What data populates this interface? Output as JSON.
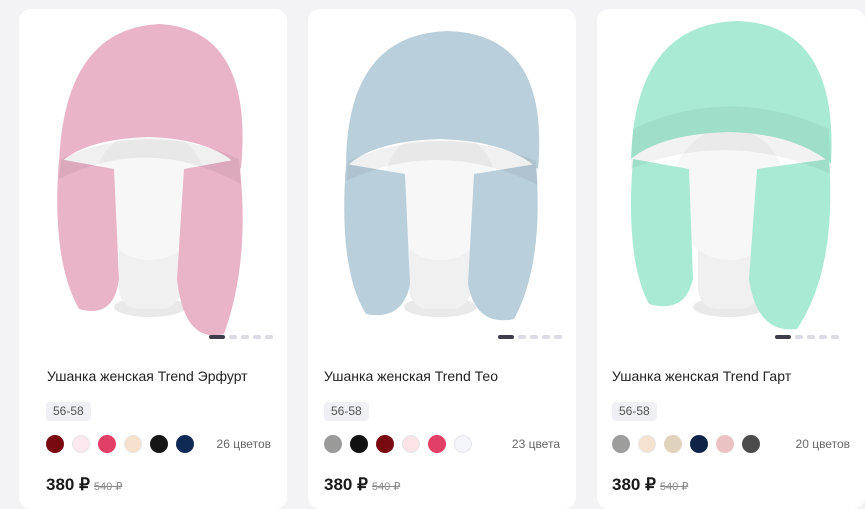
{
  "products": [
    {
      "title": "Ушанка женская Trend Эрфурт",
      "size": "56-58",
      "colors_count": "26 цветов",
      "price": "380 ₽",
      "old_price": "540 ₽",
      "hat_color": "#e9b3c8",
      "swatches": [
        "#7a0a12",
        "#fce8ee",
        "#e23f66",
        "#f5e1cc",
        "#161616",
        "#0f2a55"
      ]
    },
    {
      "title": "Ушанка женская Trend Тео",
      "size": "56-58",
      "colors_count": "23 цвета",
      "price": "380 ₽",
      "old_price": "540 ₽",
      "hat_color": "#b9cfdc",
      "swatches": [
        "#9a9a98",
        "#111111",
        "#7a0a12",
        "#fbe3e8",
        "#e23f66",
        "#f3f5fb"
      ]
    },
    {
      "title": "Ушанка женская Trend Гарт",
      "size": "56-58",
      "colors_count": "20 цветов",
      "price": "380 ₽",
      "old_price": "540 ₽",
      "hat_color": "#a8ead3",
      "swatches": [
        "#9d9d9b",
        "#f5e2cf",
        "#dfd3bc",
        "#0d2447",
        "#eac2c3",
        "#4b4b4b"
      ]
    }
  ]
}
